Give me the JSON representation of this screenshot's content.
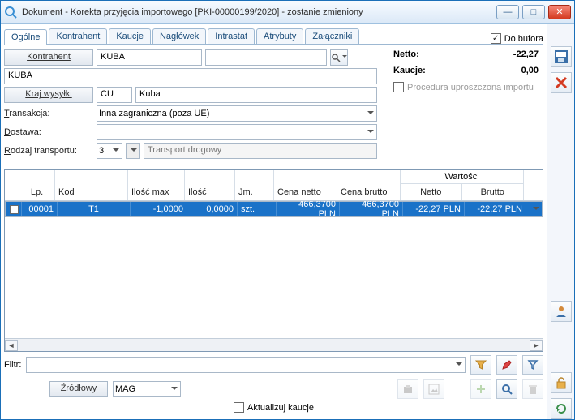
{
  "title": "Dokument - Korekta przyjęcia importowego [PKI-00000199/2020]  - zostanie zmieniony",
  "winbtns": {
    "min": "—",
    "max": "□",
    "close": "✕"
  },
  "buffer": {
    "checked": true,
    "label": "Do bufora"
  },
  "tabs": [
    "Ogólne",
    "Kontrahent",
    "Kaucje",
    "Nagłówek",
    "Intrastat",
    "Atrybuty",
    "Załączniki"
  ],
  "form": {
    "kontrahent_btn": "Kontrahent",
    "kontrahent_code": "KUBA",
    "kontrahent_name": "KUBA",
    "kraj_btn": "Kraj wysyłki",
    "kraj_code": "CU",
    "kraj_name": "Kuba",
    "transakcja_lbl": "Transakcja:",
    "transakcja_val": "Inna zagraniczna (poza UE)",
    "dostawa_lbl": "Dostawa:",
    "dostawa_val": "",
    "rodzaj_lbl": "Rodzaj transportu:",
    "rodzaj_num": "3",
    "rodzaj_txt": "Transport drogowy"
  },
  "summary": {
    "netto_lbl": "Netto:",
    "netto_val": "-22,27",
    "kaucje_lbl": "Kaucje:",
    "kaucje_val": "0,00",
    "proc_label": "Procedura uproszczona importu",
    "proc_checked": false
  },
  "grid": {
    "headers": {
      "lp": "Lp.",
      "kod": "Kod",
      "iloscmax": "Ilość max",
      "ilosc": "Ilość",
      "jm": "Jm.",
      "cenan": "Cena netto",
      "cenab": "Cena brutto",
      "wart_group": "Wartości",
      "wartn": "Netto",
      "wartb": "Brutto"
    },
    "rows": [
      {
        "lp": "00001",
        "kod": "T1",
        "iloscmax": "-1,0000",
        "ilosc": "0,0000",
        "jm": "szt.",
        "cenan": "466,3700 PLN",
        "cenab": "466,3700 PLN",
        "wartn": "-22,27 PLN",
        "wartb": "-22,27 PLN"
      }
    ]
  },
  "filter": {
    "label": "Filtr:",
    "value": ""
  },
  "source": {
    "label": "Źródłowy",
    "value": "MAG"
  },
  "aktualizuj": {
    "checked": false,
    "label": "Aktualizuj kaucje"
  }
}
